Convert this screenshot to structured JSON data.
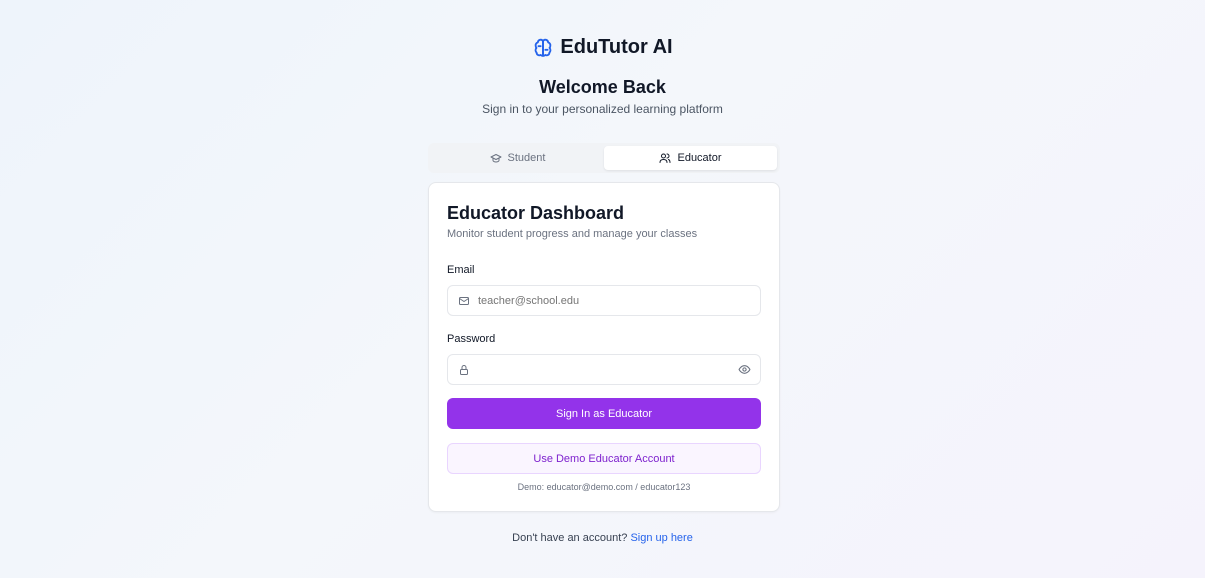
{
  "brand": {
    "name": "EduTutor AI",
    "icon": "brain-icon",
    "icon_color": "#2563eb"
  },
  "header": {
    "title": "Welcome Back",
    "subtitle": "Sign in to your personalized learning platform"
  },
  "tabs": [
    {
      "label": "Student",
      "icon": "graduation-cap-icon",
      "active": false
    },
    {
      "label": "Educator",
      "icon": "users-icon",
      "active": true
    }
  ],
  "card": {
    "title": "Educator Dashboard",
    "description": "Monitor student progress and manage your classes",
    "email": {
      "label": "Email",
      "placeholder": "teacher@school.edu",
      "value": "",
      "icon": "mail-icon"
    },
    "password": {
      "label": "Password",
      "placeholder": "",
      "value": "",
      "icon": "lock-icon",
      "toggle_icon": "eye-icon"
    },
    "submit_label": "Sign In as Educator",
    "demo_label": "Use Demo Educator Account",
    "demo_note": "Demo: educator@demo.com / educator123"
  },
  "footer": {
    "prompt": "Don't have an account?",
    "link": "Sign up here"
  },
  "colors": {
    "primary": "#9333ea",
    "demo_bg": "#faf5ff",
    "demo_text": "#7e22ce",
    "link": "#2563eb"
  }
}
